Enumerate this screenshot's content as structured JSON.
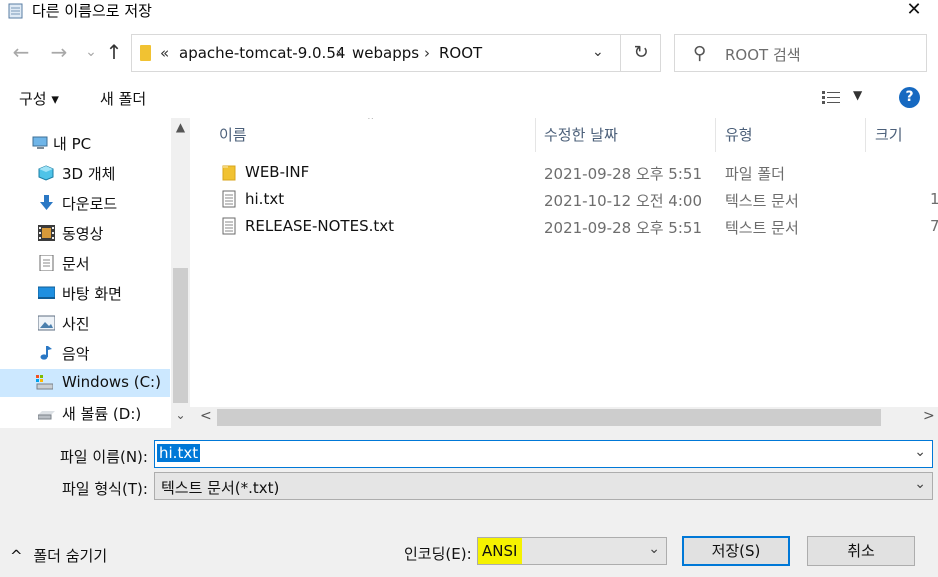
{
  "window": {
    "title": "다른 이름으로 저장",
    "close_glyph": "✕"
  },
  "nav": {
    "back_glyph": "←",
    "forward_glyph": "→",
    "recent_glyph": "⌄",
    "up_glyph": "↑",
    "breadcrumb_overflow": "«",
    "breadcrumbs": [
      "apache-tomcat-9.0.54",
      "webapps",
      "ROOT"
    ],
    "separator": "›",
    "dropdown_glyph": "⌄",
    "refresh_glyph": "↻"
  },
  "search": {
    "placeholder": "ROOT 검색",
    "icon": "search-icon"
  },
  "toolbar": {
    "organize_label": "구성 ▾",
    "new_folder_label": "새 폴더",
    "view_dropdown_glyph": "▼",
    "help_glyph": "?"
  },
  "sidebar": {
    "items": [
      {
        "label": "내 PC",
        "icon": "pc-icon"
      },
      {
        "label": "3D 개체",
        "icon": "3d-objects-icon"
      },
      {
        "label": "다운로드",
        "icon": "download-icon"
      },
      {
        "label": "동영상",
        "icon": "video-icon"
      },
      {
        "label": "문서",
        "icon": "document-icon"
      },
      {
        "label": "바탕 화면",
        "icon": "desktop-icon"
      },
      {
        "label": "사진",
        "icon": "pictures-icon"
      },
      {
        "label": "음악",
        "icon": "music-icon"
      },
      {
        "label": "Windows (C:)",
        "icon": "drive-c-icon",
        "selected": true
      },
      {
        "label": "새 볼륨 (D:)",
        "icon": "drive-d-icon"
      }
    ],
    "scroll_up_glyph": "▲",
    "scroll_down_glyph": "⌄"
  },
  "files": {
    "columns": [
      "이름",
      "수정한 날짜",
      "유형",
      "크기"
    ],
    "sort_glyph": "⌃",
    "rows": [
      {
        "name": "WEB-INF",
        "date": "2021-09-28 오후 5:51",
        "type": "파일 폴더",
        "size": "",
        "icon": "folder-icon"
      },
      {
        "name": "hi.txt",
        "date": "2021-10-12 오전 4:00",
        "type": "텍스트 문서",
        "size": "1",
        "icon": "text-file-icon"
      },
      {
        "name": "RELEASE-NOTES.txt",
        "date": "2021-09-28 오후 5:51",
        "type": "텍스트 문서",
        "size": "7",
        "icon": "text-file-icon"
      }
    ],
    "scroll_left_glyph": "<",
    "scroll_right_glyph": ">"
  },
  "form": {
    "filename_label": "파일 이름(N):",
    "filename_value": "hi.txt",
    "filetype_label": "파일 형식(T):",
    "filetype_value": "텍스트 문서(*.txt)",
    "encoding_label": "인코딩(E):",
    "encoding_value": "ANSI",
    "save_label": "저장(S)",
    "cancel_label": "취소",
    "hide_folders_label": "폴더 숨기기",
    "chevron_glyph": "⌄",
    "hide_folders_glyph": "^"
  },
  "colors": {
    "accent": "#0078d7",
    "selected_bg": "#cce8ff",
    "highlight": "#f5f200"
  }
}
